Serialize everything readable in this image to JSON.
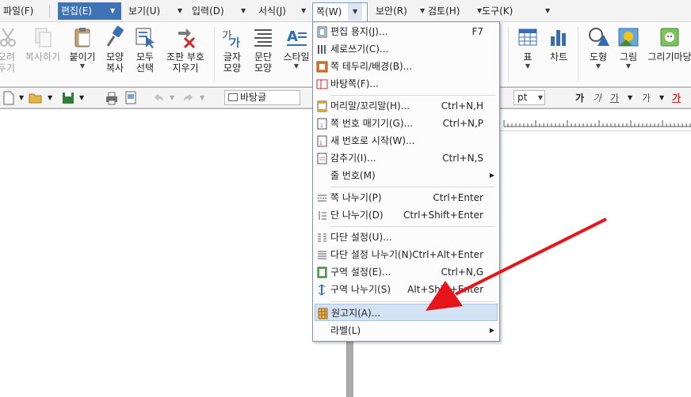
{
  "menubar": {
    "items": [
      {
        "label": "파일(F)"
      },
      {
        "label": "편집(E)"
      },
      {
        "label": "보기(U)"
      },
      {
        "label": "입력(D)"
      },
      {
        "label": "서식(J)"
      },
      {
        "label": "쪽(W)"
      },
      {
        "label": "보안(R)"
      },
      {
        "label": "검토(H)"
      },
      {
        "label": "도구(K)"
      }
    ],
    "active": "편집(E)",
    "open": "쪽(W)"
  },
  "ribbon": {
    "buttons": [
      {
        "label_line1": "오려",
        "label_line2": "두기"
      },
      {
        "label_line1": "복사하기",
        "label_line2": ""
      },
      {
        "label_line1": "붙이기",
        "label_line2": ""
      },
      {
        "label_line1": "모양",
        "label_line2": "복사"
      },
      {
        "label_line1": "모두",
        "label_line2": "선택"
      },
      {
        "label_line1": "조판 부호",
        "label_line2": "지우기"
      },
      {
        "label_line1": "글자",
        "label_line2": "모양"
      },
      {
        "label_line1": "문단",
        "label_line2": "모양"
      },
      {
        "label_line1": "스타일",
        "label_line2": ""
      },
      {
        "label_line1": "표",
        "label_line2": ""
      },
      {
        "label_line1": "차트",
        "label_line2": ""
      },
      {
        "label_line1": "도형",
        "label_line2": ""
      },
      {
        "label_line1": "그림",
        "label_line2": ""
      },
      {
        "label_line1": "그리기마당",
        "label_line2": ""
      }
    ]
  },
  "toolbar": {
    "style_combo": "바탕글",
    "unit_combo": "pt",
    "format_glyph": "가"
  },
  "dropdown": {
    "items": [
      {
        "label": "편집 용지(J)...",
        "shortcut": "F7",
        "icon": "page-setup-icon"
      },
      {
        "label": "세로쓰기(C)...",
        "shortcut": "",
        "icon": "vertical-writing-icon"
      },
      {
        "label": "쪽 테두리/배경(B)...",
        "shortcut": "",
        "icon": "page-border-icon"
      },
      {
        "label": "바탕쪽(F)...",
        "shortcut": "",
        "icon": "master-page-icon"
      },
      {
        "label": "머리말/꼬리말(H)...",
        "shortcut": "Ctrl+N,H",
        "icon": "header-footer-icon"
      },
      {
        "label": "쪽 번호 매기기(G)...",
        "shortcut": "Ctrl+N,P",
        "icon": "page-number-icon"
      },
      {
        "label": "새 번호로 시작(W)...",
        "shortcut": "",
        "icon": "new-number-icon"
      },
      {
        "label": "감추기(I)...",
        "shortcut": "Ctrl+N,S",
        "icon": "hide-icon"
      },
      {
        "label": "줄 번호(M)",
        "shortcut": "",
        "icon": ""
      },
      {
        "label": "쪽 나누기(P)",
        "shortcut": "Ctrl+Enter",
        "icon": "page-break-icon"
      },
      {
        "label": "단 나누기(D)",
        "shortcut": "Ctrl+Shift+Enter",
        "icon": "column-break-icon"
      },
      {
        "label": "다단 설정(U)...",
        "shortcut": "",
        "icon": "multi-column-icon"
      },
      {
        "label": "다단 설정 나누기(N)",
        "shortcut": "Ctrl+Alt+Enter",
        "icon": "multi-column-break-icon"
      },
      {
        "label": "구역 설정(E)...",
        "shortcut": "Ctrl+N,G",
        "icon": "section-setup-icon"
      },
      {
        "label": "구역 나누기(S)",
        "shortcut": "Alt+Shift+Enter",
        "icon": "section-break-icon"
      },
      {
        "label": "원고지(A)...",
        "shortcut": "",
        "icon": "manuscript-paper-icon"
      },
      {
        "label": "라벨(L)",
        "shortcut": "",
        "icon": ""
      }
    ]
  },
  "colors": {
    "menu_active": "#3e73b5",
    "highlight": "#d4e3f4",
    "arrow": "#e8141b"
  }
}
